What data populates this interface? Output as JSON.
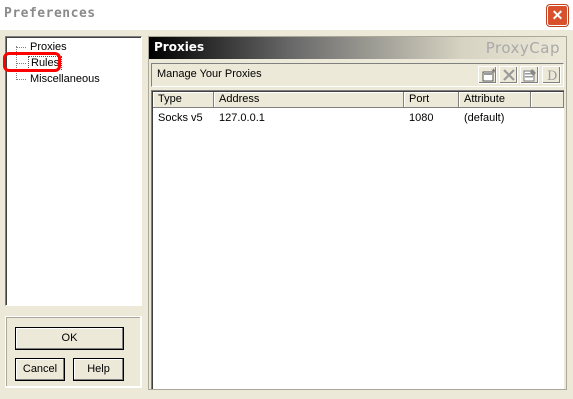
{
  "window": {
    "title": "Preferences",
    "close_label": "✕"
  },
  "tree": {
    "items": [
      {
        "label": "Proxies"
      },
      {
        "label": "Rules"
      },
      {
        "label": "Miscellaneous"
      }
    ]
  },
  "buttons": {
    "ok": "OK",
    "cancel": "Cancel",
    "help": "Help"
  },
  "panel": {
    "title": "Proxies",
    "brand": "ProxyCap",
    "subtitle": "Manage Your Proxies",
    "toolbar": [
      "new-proxy-icon",
      "delete-icon",
      "properties-icon",
      "default-icon"
    ]
  },
  "table": {
    "columns": [
      "Type",
      "Address",
      "Port",
      "Attribute"
    ],
    "rows": [
      [
        "Socks v5",
        "127.0.0.1",
        "1080",
        "(default)"
      ]
    ]
  },
  "colors": {
    "highlight": "#ff0000",
    "close": "#d9512c",
    "face": "#ece9d8"
  }
}
